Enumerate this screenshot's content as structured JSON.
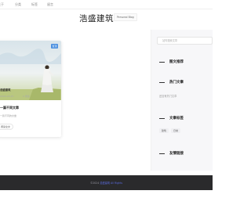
{
  "nav": {
    "items": [
      {
        "label": "关于"
      },
      {
        "label": "分类"
      },
      {
        "label": "标签"
      },
      {
        "label": "留言"
      }
    ]
  },
  "site": {
    "title": "浩盛建筑",
    "subtitle": "Personal Blog"
  },
  "post": {
    "badge": "置顶",
    "author": "浩盛建筑",
    "date": "2024-03-15",
    "views": "0 阅读",
    "title": "一篇不同文章",
    "excerpt": "一篇不同的文章",
    "read_more": "阅读全文"
  },
  "sidebar": {
    "search_placeholder": "站内搜索文章",
    "widgets": [
      {
        "title": "图文推荐"
      },
      {
        "title": "热门文章"
      },
      {
        "title": "文章标签"
      },
      {
        "title": "友情链接"
      }
    ],
    "hot_empty": "还没有热门文章",
    "tags": [
      "建筑",
      "日常"
    ]
  },
  "footer": {
    "copyright": "©2024",
    "link_text": "浩盛建筑 All Rights"
  },
  "colors": {
    "accent": "#4a8fe0",
    "footer_bg": "#2a2a2c",
    "link": "#5a6be0"
  }
}
